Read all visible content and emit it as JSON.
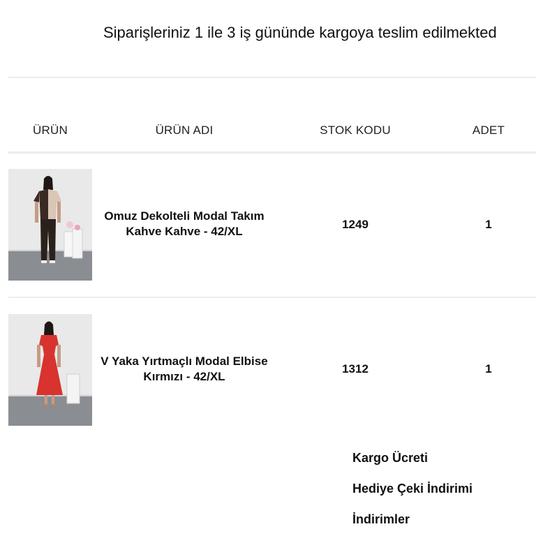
{
  "notice": "Siparişleriniz 1 ile 3 iş gününde kargoya teslim edilmekted",
  "table": {
    "headers": [
      "ÜRÜN",
      "ÜRÜN ADI",
      "STOK KODU",
      "ADET"
    ],
    "rows": [
      {
        "image": "product-photo-brown-beige-two-piece-set",
        "name_line1": "Omuz Dekolteli Modal Takım",
        "name_line2": "Kahve Kahve - 42/XL",
        "sku": "1249",
        "qty": "1"
      },
      {
        "image": "product-photo-red-dress",
        "name_line1": "V Yaka Yırtmaçlı Modal Elbise",
        "name_line2": "Kırmızı - 42/XL",
        "sku": "1312",
        "qty": "1"
      }
    ]
  },
  "summary": {
    "shipping_label": "Kargo Ücreti",
    "gift_card_label": "Hediye Çeki İndirimi",
    "discounts_label": "İndirimler"
  },
  "colors": {
    "divider": "#ececec",
    "text": "#111111",
    "dress_red": "#d8332e",
    "set_brown": "#3b2a23",
    "set_beige": "#d9c6b4"
  }
}
